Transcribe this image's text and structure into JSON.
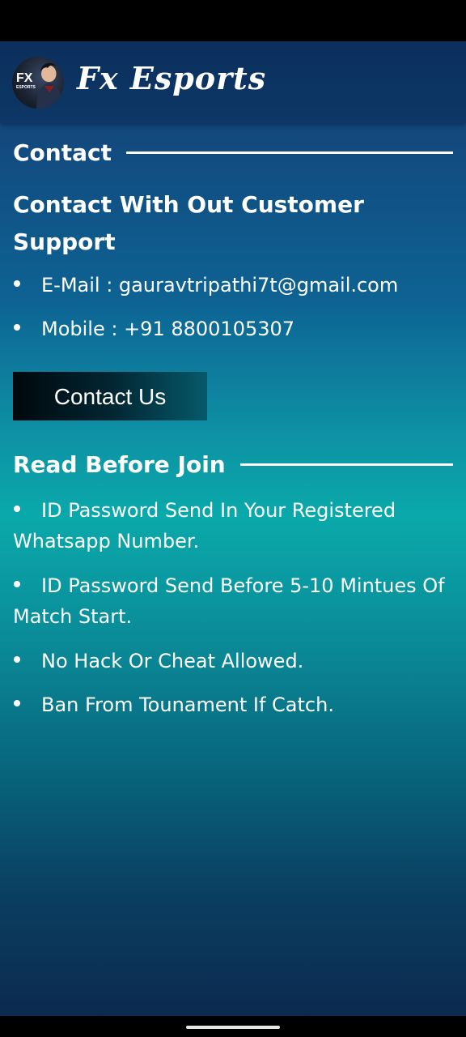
{
  "app": {
    "title": "Fx Esports",
    "logo_text": "FX",
    "logo_subtext": "ESPORTS"
  },
  "contact": {
    "heading": "Contact",
    "support_title": "Contact With Out Customer Support",
    "items": [
      "E-Mail : gauravtripathi7t@gmail.com",
      "Mobile : +91 8800105307"
    ],
    "button_label": "Contact Us"
  },
  "rules": {
    "heading": "Read Before Join",
    "items": [
      "ID Password Send In Your Registered Whatsapp Number.",
      "ID Password Send Before 5-10 Mintues Of Match Start.",
      "No Hack Or Cheat Allowed.",
      "Ban From Tounament If Catch."
    ]
  },
  "colors": {
    "header_bg": "#0c2f5d",
    "gradient_top": "#13477c",
    "gradient_mid": "#0aa9aa",
    "gradient_bottom": "#0b2a4e",
    "text": "#ffffff"
  }
}
